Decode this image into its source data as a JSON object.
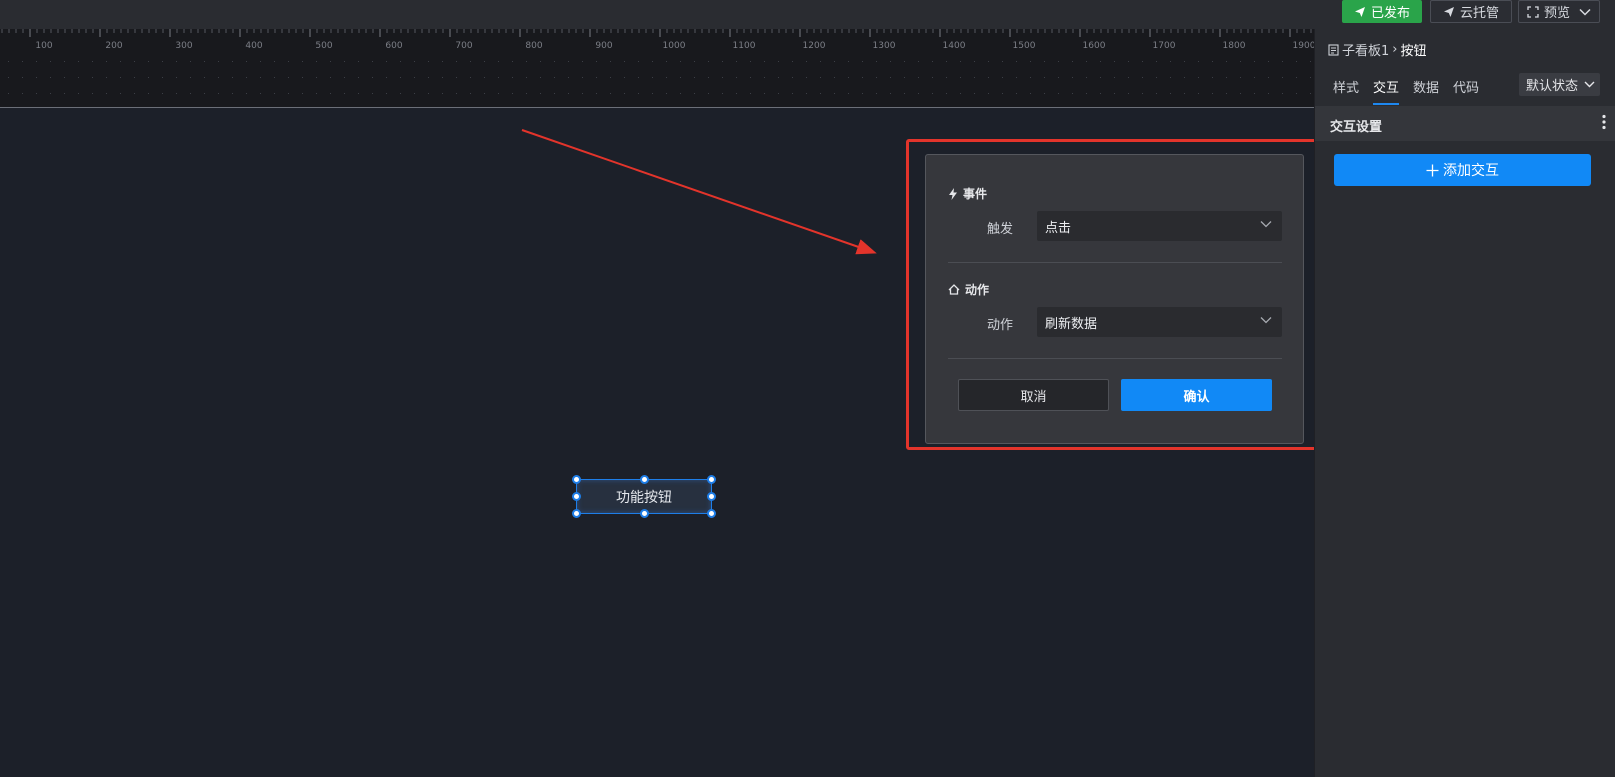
{
  "topbar": {
    "publish_label": "已发布",
    "cloud_label": "云托管",
    "preview_label": "预览",
    "publish_icon": "paper-plane-icon",
    "cloud_icon": "paper-plane-icon",
    "preview_icon": "fullscreen-icon"
  },
  "ruler": {
    "ticks": [
      "100",
      "200",
      "300",
      "400",
      "500",
      "600",
      "700",
      "800",
      "900",
      "1000",
      "1100",
      "1200",
      "1300",
      "1400",
      "1500",
      "1600",
      "1700",
      "1800",
      "1900"
    ]
  },
  "canvas": {
    "widget_label": "功能按钮"
  },
  "dialog": {
    "event_title": "事件",
    "event_icon": "lightning-icon",
    "trigger_label": "触发",
    "trigger_value": "点击",
    "action_title": "动作",
    "action_icon": "action-icon",
    "action_label": "动作",
    "action_value": "刷新数据",
    "cancel_label": "取消",
    "confirm_label": "确认"
  },
  "panel": {
    "breadcrumb": {
      "icon": "document-icon",
      "parent": "子看板1",
      "separator": "›",
      "current": "按钮"
    },
    "tabs": [
      {
        "label": "样式",
        "active": false
      },
      {
        "label": "交互",
        "active": true
      },
      {
        "label": "数据",
        "active": false
      },
      {
        "label": "代码",
        "active": false
      }
    ],
    "state_select": "默认状态",
    "section_title": "交互设置",
    "add_button": "添加交互"
  },
  "colors": {
    "accent": "#1189f6",
    "publish": "#2aa44a",
    "highlight": "#e3342b",
    "selection": "#1e7ee8"
  }
}
